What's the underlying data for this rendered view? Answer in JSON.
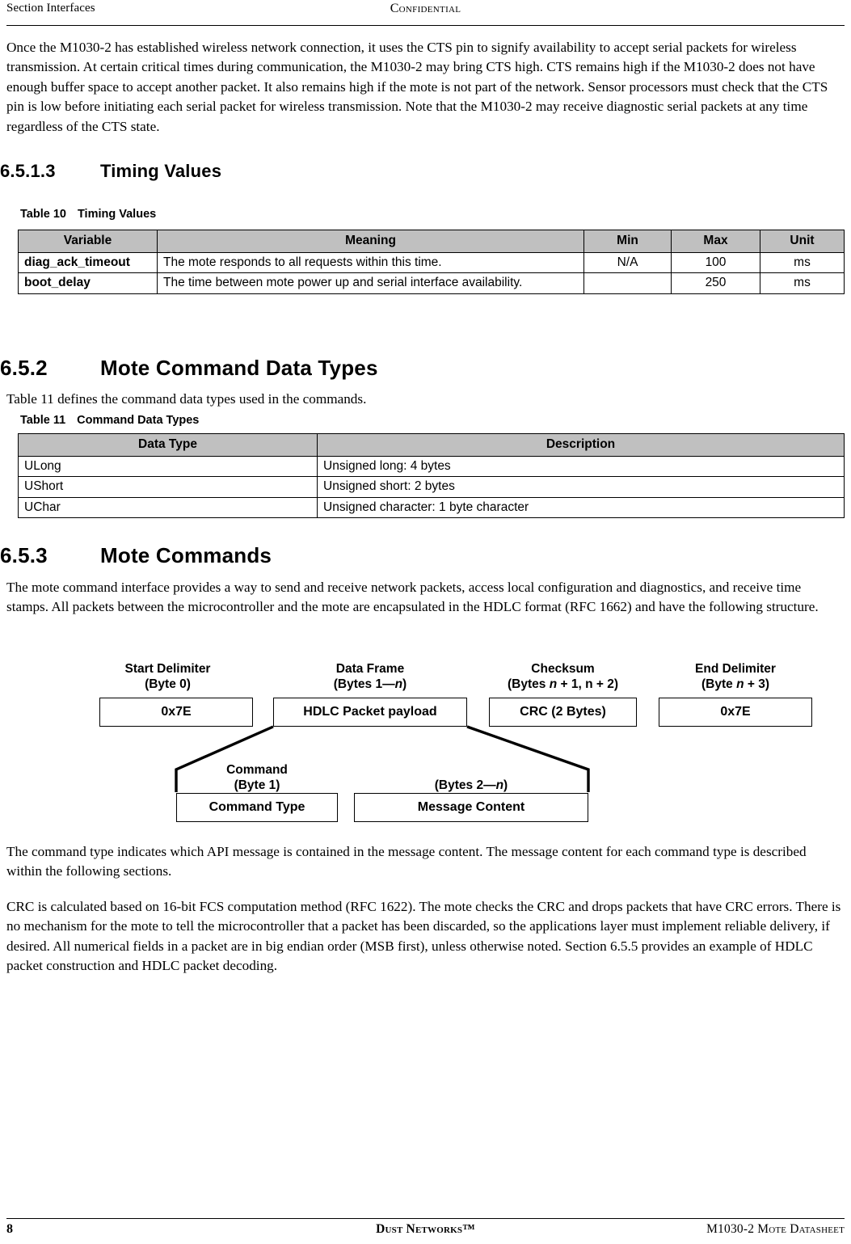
{
  "header": {
    "left": "Section Interfaces",
    "center": "Confidential"
  },
  "intro_paragraph": "Once the M1030-2 has established wireless network connection, it uses the CTS pin to signify availability to accept serial packets for wireless transmission. At certain critical times during communication, the M1030-2 may bring CTS high. CTS remains high if the M1030-2 does not have enough buffer space to accept another packet. It also remains high if the mote is not part of the network. Sensor processors must check that the CTS pin is low before initiating each serial packet for wireless transmission. Note that the M1030-2 may receive diagnostic serial packets at any time regardless of the CTS state.",
  "section_6513": {
    "number": "6.5.1.3",
    "title": "Timing Values"
  },
  "table10": {
    "caption_number": "Table 10",
    "caption_title": "Timing Values",
    "columns": [
      "Variable",
      "Meaning",
      "Min",
      "Max",
      "Unit"
    ],
    "rows": [
      {
        "variable": "diag_ack_timeout",
        "meaning": "The mote responds to all requests within this time.",
        "min": "N/A",
        "max": "100",
        "unit": "ms"
      },
      {
        "variable": "boot_delay",
        "meaning": "The time between mote power up and serial interface availability.",
        "min": "",
        "max": "250",
        "unit": "ms"
      }
    ]
  },
  "section_652": {
    "number": "6.5.2",
    "title": "Mote Command Data Types"
  },
  "table11_intro": "Table 11 defines the command data types used in the commands.",
  "table11": {
    "caption_number": "Table 11",
    "caption_title": "Command Data Types",
    "columns": [
      "Data Type",
      "Description"
    ],
    "rows": [
      {
        "type": "ULong",
        "description": "Unsigned long: 4 bytes"
      },
      {
        "type": "UShort",
        "description": "Unsigned short: 2 bytes"
      },
      {
        "type": "UChar",
        "description": "Unsigned character: 1 byte character"
      }
    ]
  },
  "section_653": {
    "number": "6.5.3",
    "title": "Mote Commands"
  },
  "mote_commands_paragraph": "The mote command interface provides a way to send and receive network packets, access local configuration and diagnostics, and receive time stamps. All packets between the microcontroller and the mote are encapsulated in the HDLC format (RFC 1662) and have the following structure.",
  "packet_diagram": {
    "fields": [
      {
        "label": "Start Delimiter",
        "bytes": "(Byte 0)",
        "box": "0x7E"
      },
      {
        "label": "Data Frame",
        "bytes_prefix": "(Bytes 1—",
        "bytes_italic": "n",
        "bytes_suffix": ")",
        "box": "HDLC Packet payload"
      },
      {
        "label": "Checksum",
        "bytes_prefix": "(Bytes ",
        "bytes_italic": "n",
        "bytes_suffix": " + 1, n + 2)",
        "box": "CRC (2 Bytes)"
      },
      {
        "label": "End Delimiter",
        "bytes_prefix": "(Byte ",
        "bytes_italic": "n",
        "bytes_suffix": " + 3)",
        "box": "0x7E"
      }
    ],
    "expansion": [
      {
        "label": "Command",
        "bytes": "(Byte 1)",
        "box": "Command Type"
      },
      {
        "label": "",
        "bytes_prefix": "(Bytes 2—",
        "bytes_italic": "n",
        "bytes_suffix": ")",
        "box": "Message Content"
      }
    ]
  },
  "command_type_paragraph": "The command type indicates which API message is contained in the message content. The message content for each command type is described within the following sections.",
  "crc_paragraph": "CRC is calculated based on 16-bit FCS computation method (RFC 1622). The mote checks the CRC and drops packets that have CRC errors. There is no mechanism for the mote to tell the microcontroller that a packet has been discarded, so the applications layer must implement reliable delivery, if desired. All numerical fields in a packet are in big endian order (MSB first), unless otherwise noted. Section 6.5.5 provides an example of HDLC packet construction and HDLC packet decoding.",
  "footer": {
    "page_number": "8",
    "center": "Dust Networks™",
    "right": "M1030-2 Mote Datasheet"
  }
}
